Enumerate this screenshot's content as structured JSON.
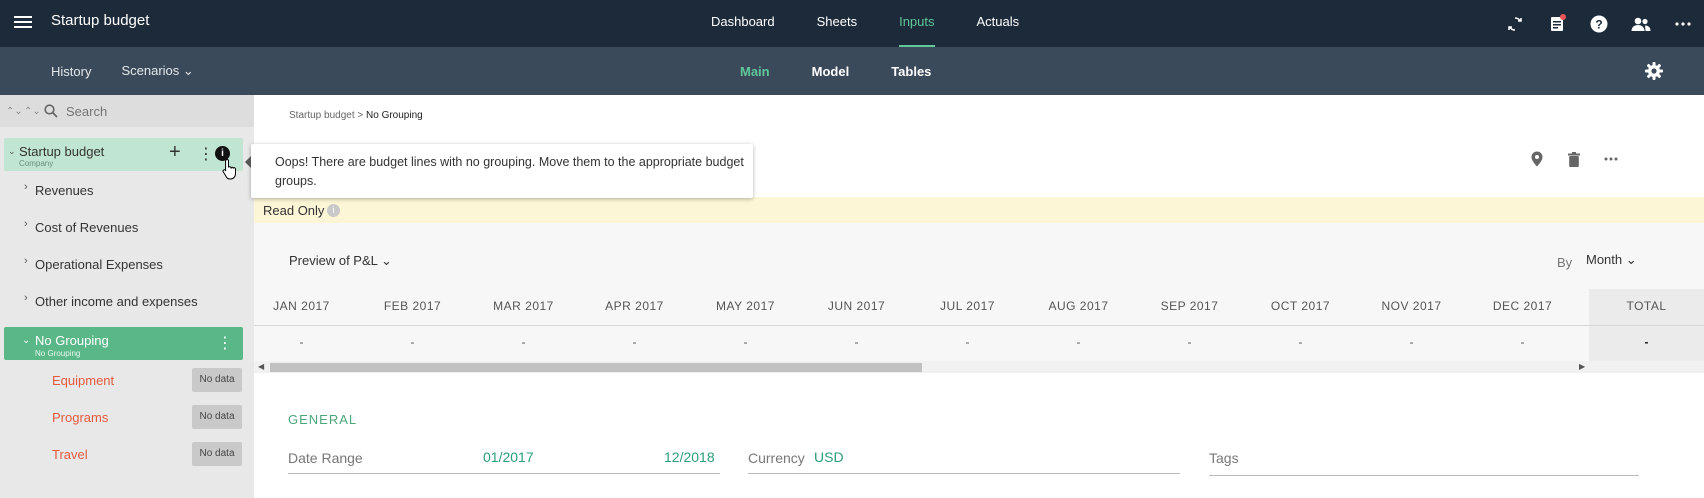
{
  "app": {
    "title": "Startup budget"
  },
  "top_nav": [
    "Dashboard",
    "Sheets",
    "Inputs",
    "Actuals"
  ],
  "top_nav_active": "Inputs",
  "top_icons": [
    "sync-icon",
    "notifications-icon",
    "help-icon",
    "users-icon",
    "more-icon"
  ],
  "sub_nav": {
    "history": "History",
    "scenarios": "Scenarios"
  },
  "sub_tabs": [
    "Main",
    "Model",
    "Tables"
  ],
  "sub_tabs_active": "Main",
  "sidebar": {
    "search_placeholder": "Search",
    "root": {
      "label": "Startup budget",
      "sub": "Company"
    },
    "categories": [
      "Revenues",
      "Cost of Revenues",
      "Operational Expenses",
      "Other income and expenses"
    ],
    "group": {
      "label": "No Grouping",
      "sub": "No Grouping"
    },
    "lines": [
      {
        "label": "Equipment",
        "badge": "No data"
      },
      {
        "label": "Programs",
        "badge": "No data"
      },
      {
        "label": "Travel",
        "badge": "No data"
      }
    ]
  },
  "tooltip": {
    "text": "Oops! There are budget lines with no grouping. Move them to the appropriate budget groups."
  },
  "main": {
    "breadcrumb": {
      "parent": "Startup budget",
      "separator": " > ",
      "current": "No Grouping"
    },
    "readonly": "Read Only",
    "preview": "Preview of P&L",
    "by_label": "By",
    "period": "Month",
    "months": [
      "JAN 2017",
      "FEB 2017",
      "MAR 2017",
      "APR 2017",
      "MAY 2017",
      "JUN 2017",
      "JUL 2017",
      "AUG 2017",
      "SEP 2017",
      "OCT 2017",
      "NOV 2017",
      "DEC 2017",
      "TOTAL"
    ],
    "values": [
      "-",
      "-",
      "-",
      "-",
      "-",
      "-",
      "-",
      "-",
      "-",
      "-",
      "-",
      "-",
      "-"
    ],
    "general": {
      "title": "GENERAL",
      "date_range_label": "Date Range",
      "date_from": "01/2017",
      "date_to": "12/2018",
      "currency_label": "Currency",
      "currency_value": "USD",
      "tags_label": "Tags"
    }
  },
  "colors": {
    "nav_bg": "#1c2a3a",
    "subnav_bg": "#3b4a5a",
    "accent": "#5fc79a",
    "error": "#e55a3c"
  }
}
